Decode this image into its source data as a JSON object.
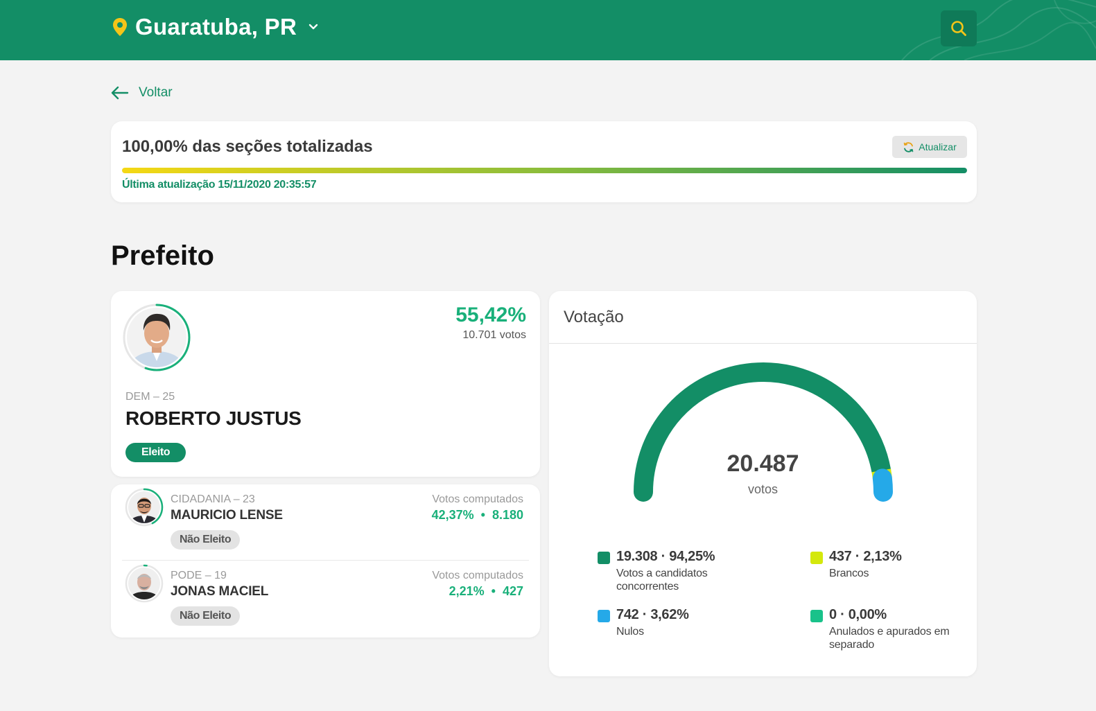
{
  "header": {
    "city": "Guaratuba, PR"
  },
  "nav": {
    "back_label": "Voltar"
  },
  "progress": {
    "title": "100,00% das seções totalizadas",
    "percent": 100,
    "refresh_label": "Atualizar",
    "updated": "Última atualização 15/11/2020 20:35:57"
  },
  "section": {
    "title": "Prefeito"
  },
  "winner": {
    "pct": "55,42%",
    "votes": "10.701 votos",
    "party": "DEM – 25",
    "name": "ROBERTO JUSTUS",
    "status": "Eleito",
    "ring_fraction": 0.5542
  },
  "others": [
    {
      "party": "CIDADANIA – 23",
      "name": "MAURICIO LENSE",
      "status": "Não Eleito",
      "votes_label": "Votos computados",
      "votes_value": "42,37%  •  8.180",
      "ring_fraction": 0.4237
    },
    {
      "party": "PODE – 19",
      "name": "JONAS MACIEL",
      "status": "Não Eleito",
      "votes_label": "Votos computados",
      "votes_value": "2,21%  •  427",
      "ring_fraction": 0.0221
    }
  ],
  "votacao": {
    "title": "Votação",
    "total": "20.487",
    "total_unit": "votos",
    "legend": [
      {
        "value": "19.308 · 94,25%",
        "label": "Votos a candidatos concorrentes",
        "color": "#138e66",
        "fraction": 0.9425
      },
      {
        "value": "437 · 2,13%",
        "label": "Brancos",
        "color": "#d4e80c",
        "fraction": 0.0213
      },
      {
        "value": "742 · 3,62%",
        "label": "Nulos",
        "color": "#25a9e8",
        "fraction": 0.0362
      },
      {
        "value": "0 · 0,00%",
        "label": "Anulados e apurados em separado",
        "color": "#19c28a",
        "fraction": 0.0
      }
    ]
  },
  "colors": {
    "primary": "#138e66",
    "accent_green": "#19b07a",
    "pin_yellow": "#f5c518"
  }
}
